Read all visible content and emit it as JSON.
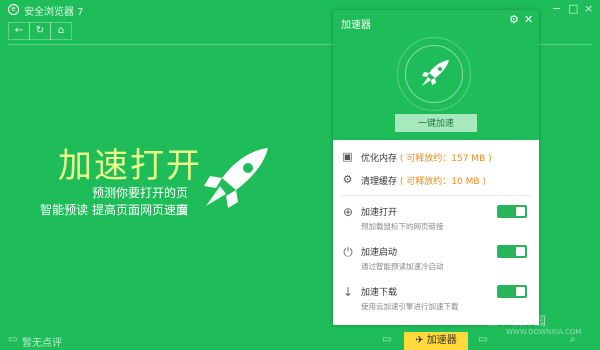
{
  "window": {
    "title": "安全浏览器 7",
    "controls": [
      "−",
      "□",
      "×"
    ]
  },
  "nav": {
    "back": "←",
    "refresh": "↻",
    "home": "⌂"
  },
  "hero": {
    "title": "加速打开",
    "line1": "预测你要打开的页面",
    "line2": "智能预读  提高页面网页速度"
  },
  "status": {
    "left_text": "暂无点评",
    "accel_tab": "加速器"
  },
  "panel": {
    "title": "加速器",
    "gear_icon": "⚙",
    "close_icon": "✕",
    "one_key": "一键加速",
    "optimize": {
      "label": "优化内存",
      "info": "( 可释放约：157 MB )"
    },
    "clean": {
      "label": "清理缓存",
      "info": "( 可释放约：10 MB )"
    },
    "items": [
      {
        "title": "加速打开",
        "desc": "预加载鼠标下的网页链接",
        "enabled": true
      },
      {
        "title": "加速启动",
        "desc": "通过智能预读加速冷启动",
        "enabled": true
      },
      {
        "title": "加速下载",
        "desc": "使用云加速引擎进行加速下载",
        "enabled": true
      }
    ]
  },
  "watermark": {
    "text": "当下软件园",
    "url": "WWW.DOWNXIA.COM"
  },
  "colors": {
    "background": "#1fbd5a",
    "toggle": "#27b45a",
    "accel_tab": "#ffd83a",
    "hero_title": "#eaff8a"
  }
}
